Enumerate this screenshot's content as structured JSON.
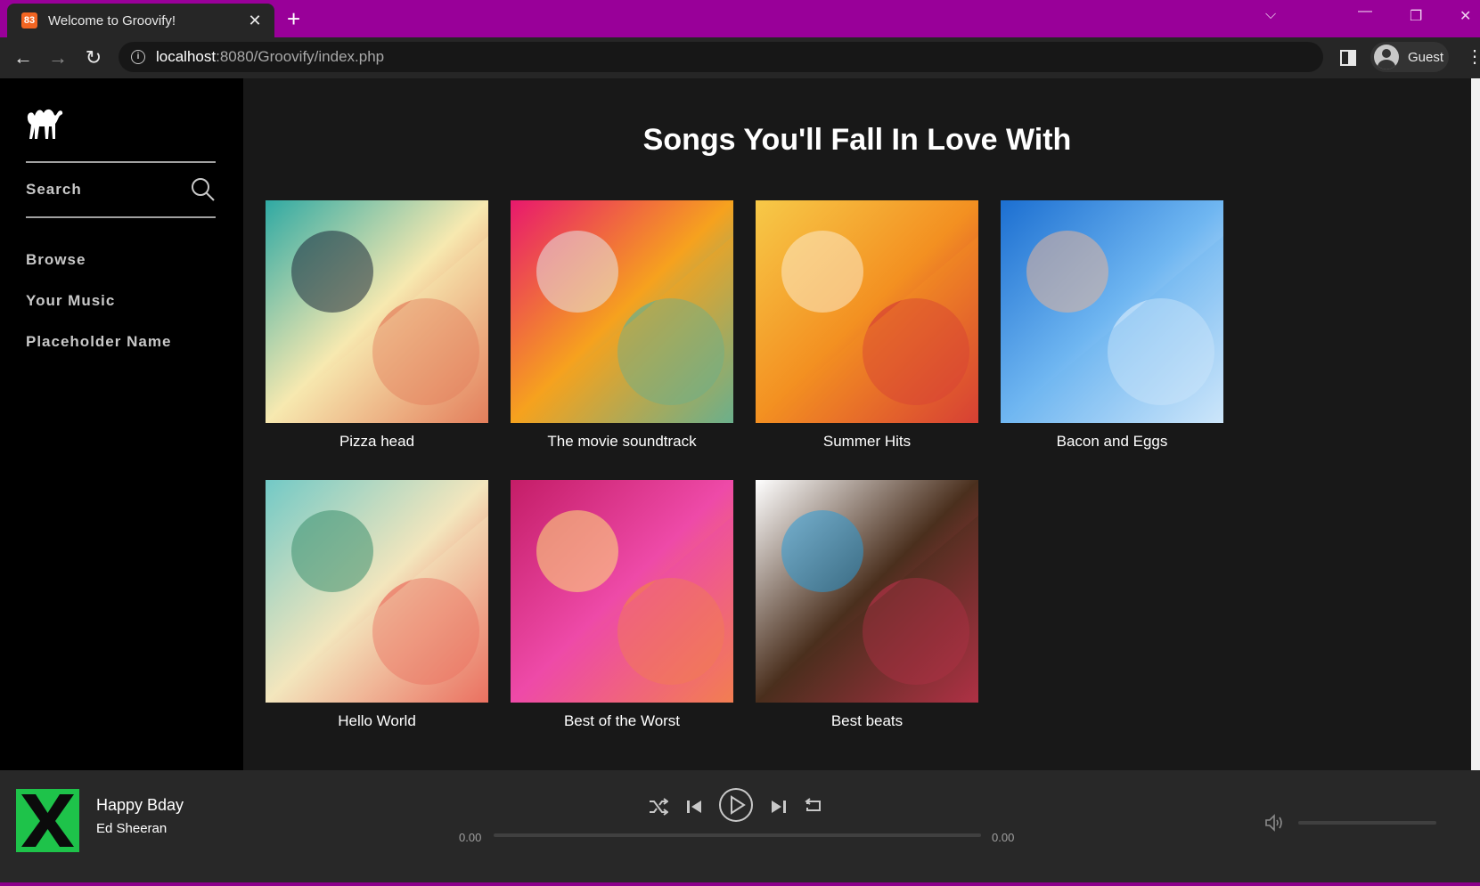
{
  "browser": {
    "tab_title": "Welcome to Groovify!",
    "favicon_glyph": "83",
    "url_host": "localhost",
    "url_rest": ":8080/Groovify/index.php",
    "profile_label": "Guest"
  },
  "sidebar": {
    "search_label": "Search",
    "nav": [
      "Browse",
      "Your Music",
      "Placeholder Name"
    ]
  },
  "main": {
    "title": "Songs You'll Fall In Love With",
    "albums": [
      {
        "title": "Pizza head",
        "colors": [
          "#2fa9a3",
          "#f7e9b0",
          "#d9452f",
          "#1d2a3a"
        ]
      },
      {
        "title": "The movie soundtrack",
        "colors": [
          "#e8186d",
          "#f6a21e",
          "#20b6c8",
          "#e6e6e6"
        ]
      },
      {
        "title": "Summer Hits",
        "colors": [
          "#f7c948",
          "#f39021",
          "#c8163e",
          "#fbe9c9"
        ]
      },
      {
        "title": "Bacon and Eggs",
        "colors": [
          "#1c6fd1",
          "#6fb6f1",
          "#ffffff",
          "#e5b59b"
        ]
      },
      {
        "title": "Hello World",
        "colors": [
          "#72c9c6",
          "#f3e6bd",
          "#e6322f",
          "#3e8f6e"
        ]
      },
      {
        "title": "Best of the Worst",
        "colors": [
          "#c41d67",
          "#ee4aa8",
          "#f59a22",
          "#ffe27a"
        ]
      },
      {
        "title": "Best beats",
        "colors": [
          "#ffffff",
          "#4a2f1d",
          "#e5335b",
          "#2b9bd6"
        ]
      }
    ]
  },
  "player": {
    "track_title": "Happy Bday",
    "artist": "Ed Sheeran",
    "current_time": "0.00",
    "total_time": "0.00",
    "progress": 0,
    "volume": 0,
    "icons": [
      "shuffle-icon",
      "previous-icon",
      "play-icon",
      "next-icon",
      "repeat-icon",
      "volume-icon"
    ]
  }
}
